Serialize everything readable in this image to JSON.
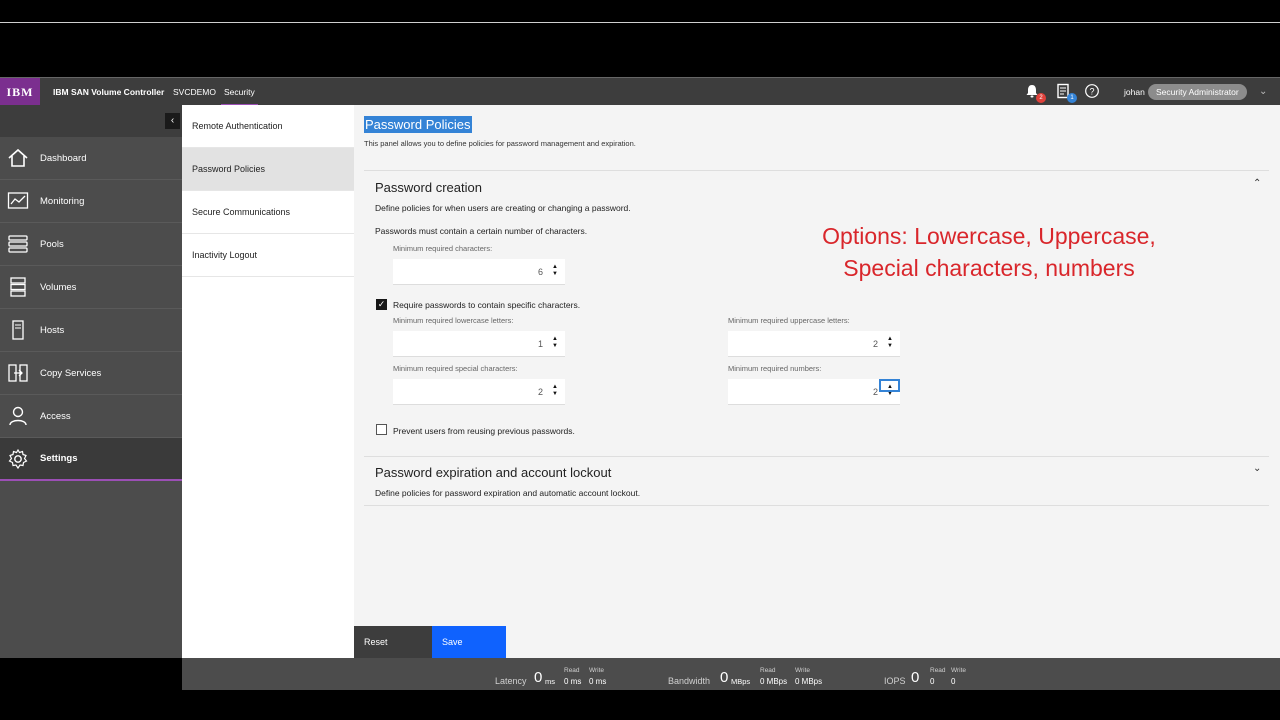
{
  "header": {
    "logo": "IBM",
    "app_title": "IBM SAN Volume Controller",
    "system_name": "SVCDEMO",
    "current_section": "Security",
    "notifications_count": "2",
    "tasks_count": "1",
    "user_name": "johan",
    "user_role": "Security Administrator",
    "colors": {
      "accent": "#9b4fb5",
      "logo_bg": "#7b2f8f",
      "alert": "#e0413b",
      "info": "#3483d6"
    }
  },
  "sidebar": {
    "items": [
      {
        "label": "Dashboard",
        "icon": "home-icon"
      },
      {
        "label": "Monitoring",
        "icon": "monitoring-icon"
      },
      {
        "label": "Pools",
        "icon": "pools-icon"
      },
      {
        "label": "Volumes",
        "icon": "volumes-icon"
      },
      {
        "label": "Hosts",
        "icon": "hosts-icon"
      },
      {
        "label": "Copy Services",
        "icon": "copy-services-icon"
      },
      {
        "label": "Access",
        "icon": "access-icon"
      },
      {
        "label": "Settings",
        "icon": "gear-icon"
      }
    ]
  },
  "subnav": {
    "items": [
      {
        "label": "Remote Authentication"
      },
      {
        "label": "Password Policies"
      },
      {
        "label": "Secure Communications"
      },
      {
        "label": "Inactivity Logout"
      }
    ]
  },
  "main": {
    "title": "Password Policies",
    "description": "This panel allows you to define policies for password management and expiration.",
    "creation": {
      "title": "Password creation",
      "description": "Define policies for when users are creating or changing a password.",
      "length_note": "Passwords must contain a certain number of characters.",
      "min_chars_label": "Minimum required characters:",
      "min_chars_value": "6",
      "require_specific_label": "Require passwords to contain specific characters.",
      "require_specific_checked": true,
      "lowercase_label": "Minimum required lowercase letters:",
      "lowercase_value": "1",
      "uppercase_label": "Minimum required uppercase letters:",
      "uppercase_value": "2",
      "special_label": "Minimum required special characters:",
      "special_value": "2",
      "numbers_label": "Minimum required numbers:",
      "numbers_value": "2",
      "prevent_reuse_label": "Prevent users from reusing previous passwords.",
      "prevent_reuse_checked": false
    },
    "expiration": {
      "title": "Password expiration and account lockout",
      "description": "Define policies for password expiration and automatic account lockout."
    },
    "annotation_line1": "Options: Lowercase, Uppercase,",
    "annotation_line2": "Special characters, numbers",
    "reset_label": "Reset",
    "save_label": "Save"
  },
  "status": {
    "latency": {
      "label": "Latency",
      "value": "0",
      "unit": "ms",
      "read_h": "Read",
      "read_v": "0 ms",
      "write_h": "Write",
      "write_v": "0 ms"
    },
    "bandwidth": {
      "label": "Bandwidth",
      "value": "0",
      "unit": "MBps",
      "read_h": "Read",
      "read_v": "0 MBps",
      "write_h": "Write",
      "write_v": "0 MBps"
    },
    "iops": {
      "label": "IOPS",
      "value": "0",
      "read_h": "Read",
      "read_v": "0",
      "write_h": "Write",
      "write_v": "0"
    }
  }
}
